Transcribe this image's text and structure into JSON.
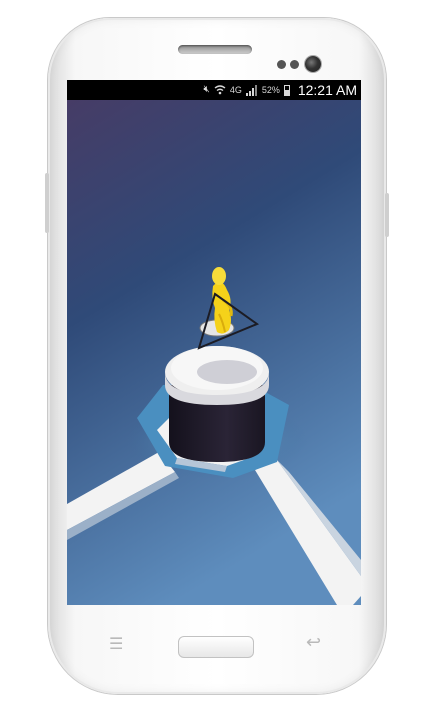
{
  "status_bar": {
    "icons": [
      "mute-icon",
      "wifi-icon",
      "lte-icon",
      "signal-icon",
      "battery-icon"
    ],
    "network_label": "4G",
    "battery_level": 0.52,
    "battery_text": "52%",
    "time": "12:21 AM"
  },
  "colors": {
    "sky_top": "#4a3f6b",
    "sky_bottom": "#5a86b8",
    "platform_white": "#f2f2f2",
    "pillar_dark": "#1f1b2a",
    "figure_yellow": "#f5d21a",
    "status_bg": "#000000"
  },
  "device": {
    "nav": [
      "menu-icon",
      "home-button",
      "back-icon"
    ]
  }
}
